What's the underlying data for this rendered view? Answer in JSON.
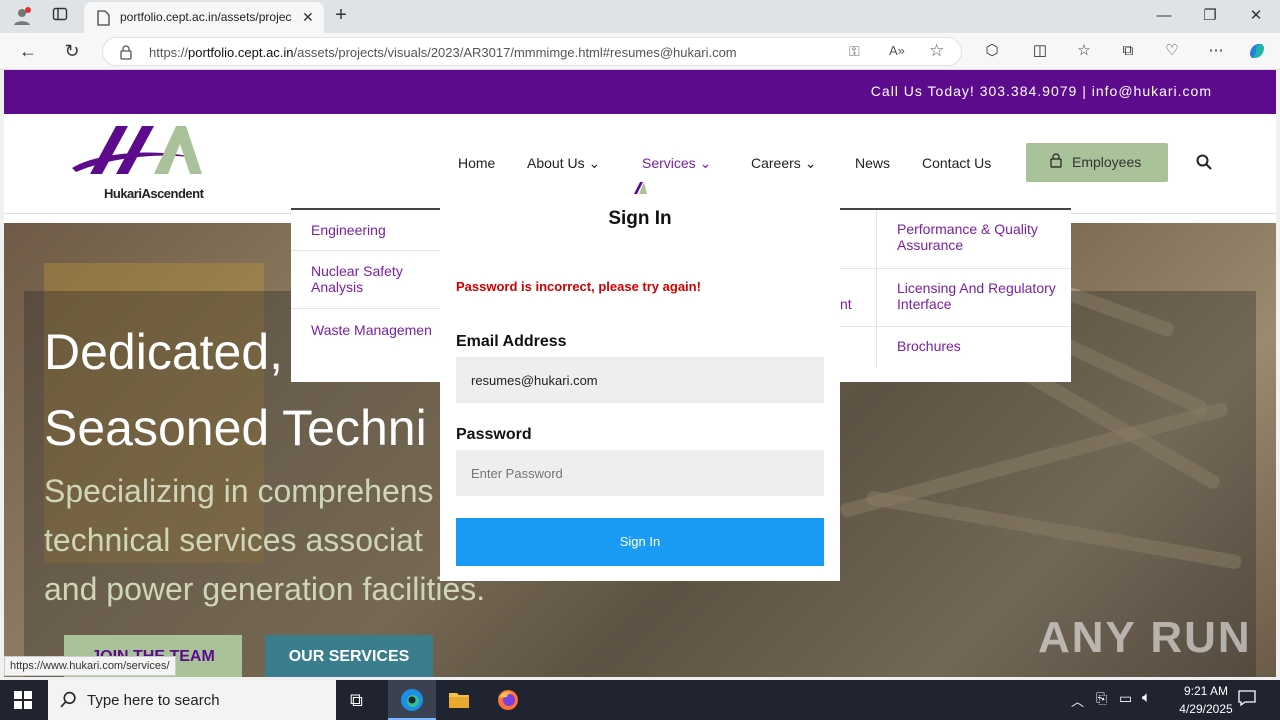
{
  "browser": {
    "tab_title": "portfolio.cept.ac.in/assets/projec",
    "url_prefix": "https://",
    "url_host": "portfolio.cept.ac.in",
    "url_path": "/assets/projects/visuals/2023/AR3017/mmmimge.html#resumes@hukari.com",
    "status_url": "https://www.hukari.com/services/"
  },
  "site": {
    "topbar_text": "Call Us Today!  303.384.9079 | info@hukari.com",
    "logo_text": "HukariAscendent",
    "nav": {
      "home": "Home",
      "about": "About Us",
      "services": "Services",
      "careers": "Careers",
      "news": "News",
      "contact": "Contact Us",
      "employees": "Employees"
    },
    "dropdown_left": [
      "Engineering",
      "Nuclear Safety Analysis",
      "Waste Managemen"
    ],
    "dropdown_mid_partial": "nt",
    "dropdown_right": [
      "Performance & Quality Assurance",
      "Licensing And Regulatory Interface",
      "Brochures"
    ],
    "hero": {
      "line1": "Dedicated,",
      "line2": "Seasoned Techni",
      "sub1": "Specializing in comprehens",
      "sub2": "technical services associat",
      "sub3": "and power generation facilities.",
      "join_btn": "JOIN THE TEAM",
      "services_btn": "OUR SERVICES",
      "watermark": "ANY RUN"
    }
  },
  "modal": {
    "title": "Sign In",
    "error": "Password is incorrect, please try again!",
    "email_label": "Email Address",
    "email_value": "resumes@hukari.com",
    "password_label": "Password",
    "password_placeholder": "Enter Password",
    "submit": "Sign In"
  },
  "taskbar": {
    "search_placeholder": "Type here to search",
    "time": "9:21 AM",
    "date": "4/29/2025"
  },
  "colors": {
    "brand_purple": "#5c0b8c",
    "link_purple": "#7b1fa2",
    "button_blue": "#1a9bf4",
    "error_red": "#d00000",
    "employees_green": "#a9c29a"
  }
}
